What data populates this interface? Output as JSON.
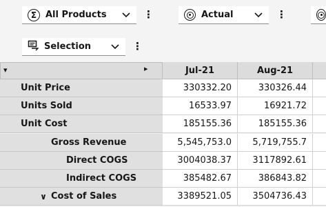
{
  "toolbar": {
    "products_label": "All Products",
    "products_icon": "sigma-icon",
    "version_label": "Actual",
    "version_icon": "target-icon",
    "selection_label": "Selection",
    "selection_icon": "selection-icon",
    "kebab": "⋮"
  },
  "grid": {
    "corner_left_arrow": "▾",
    "corner_right_arrow": "▸",
    "columns": [
      "Jul-21",
      "Aug-21"
    ],
    "rows": [
      {
        "label": "Unit Price",
        "indent": 0,
        "values": [
          "330332.20",
          "330326.44"
        ]
      },
      {
        "label": "Units Sold",
        "indent": 0,
        "values": [
          "16533.97",
          "16921.72"
        ]
      },
      {
        "label": "Unit Cost",
        "indent": 0,
        "values": [
          "185155.36",
          "185155.36"
        ]
      },
      {
        "label": "Gross Revenue",
        "indent": 1,
        "values": [
          "5,545,753.0",
          "5,719,755.7"
        ]
      },
      {
        "label": "Direct COGS",
        "indent": 2,
        "values": [
          "3004038.37",
          "3117892.61"
        ]
      },
      {
        "label": "Indirect COGS",
        "indent": 2,
        "values": [
          "385482.67",
          "386843.82"
        ]
      },
      {
        "label": "Cost of Sales",
        "indent": 1,
        "expander": "∨",
        "values": [
          "3389521.05",
          "3504736.43"
        ]
      }
    ]
  }
}
